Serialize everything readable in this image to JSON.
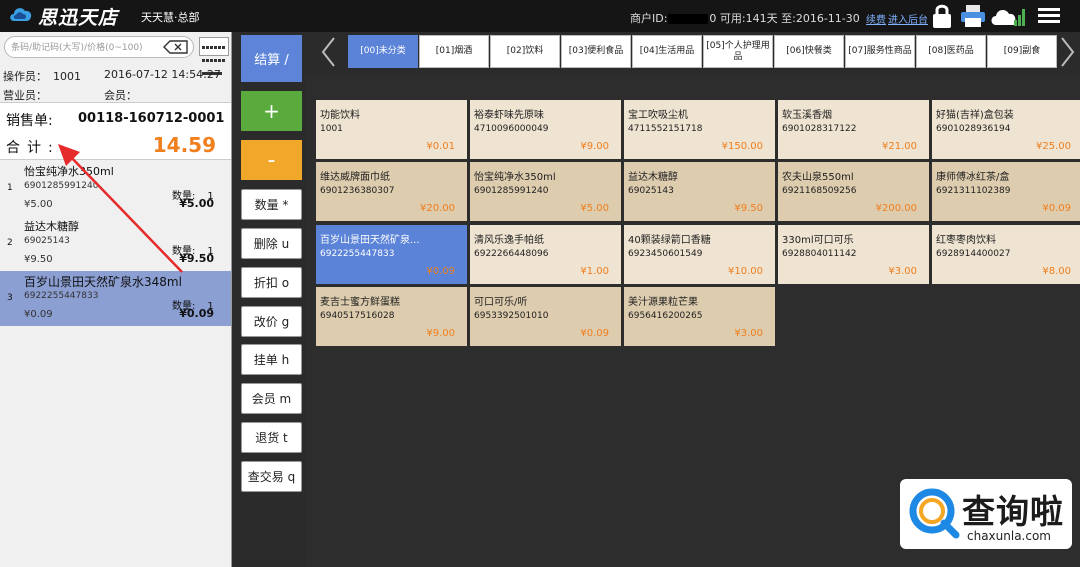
{
  "topbar": {
    "brand": "思迅天店",
    "brand_sub": "天天慧·总部",
    "merchant_prefix": "商户ID:",
    "merchant_suffix": "0 可用:141天 至:2016-11-30",
    "renew_link": "续费",
    "backend_link": "进入后台"
  },
  "search": {
    "placeholder": "条码/助记码(大写)/价格(0~100)"
  },
  "session": {
    "operator_label": "操作员：",
    "operator_value": "1001",
    "datetime": "2016-07-12 14:54:27",
    "clerk_label": "营业员：",
    "member_label": "会员："
  },
  "order": {
    "label": "销售单:",
    "number": "00118-160712-0001",
    "total_label": "合计:",
    "total_value": "14.59"
  },
  "cart": [
    {
      "index": "1",
      "name": "怡宝纯净水350ml",
      "code": "6901285991240",
      "qty_label": "数量:",
      "qty": "1",
      "price": "¥5.00",
      "subtotal": "¥5.00"
    },
    {
      "index": "2",
      "name": "益达木糖醇",
      "code": "69025143",
      "qty_label": "数量:",
      "qty": "1",
      "price": "¥9.50",
      "subtotal": "¥9.50"
    },
    {
      "index": "3",
      "name": "百岁山景田天然矿泉水348ml",
      "code": "6922255447833",
      "qty_label": "数量:",
      "qty": "1",
      "price": "¥0.09",
      "subtotal": "¥0.09"
    }
  ],
  "actions": {
    "checkout": "结算 /",
    "plus": "+",
    "minus": "-",
    "buttons": [
      "数量 *",
      "删除 u",
      "折扣 o",
      "改价 g",
      "挂单 h",
      "会员 m",
      "退货 t",
      "查交易 q"
    ]
  },
  "tabs": [
    "[00]未分类",
    "[01]烟酒",
    "[02]饮料",
    "[03]便利食品",
    "[04]生活用品",
    "[05]个人护理用品",
    "[06]快餐类",
    "[07]服务性商品",
    "[08]医药品",
    "[09]副食"
  ],
  "products": [
    {
      "name": "功能饮料",
      "code": "1001",
      "price": "¥0.01"
    },
    {
      "name": "裕泰虾味先原味",
      "code": "4710096000049",
      "price": "¥9.00"
    },
    {
      "name": "宝工吹吸尘机",
      "code": "4711552151718",
      "price": "¥150.00"
    },
    {
      "name": "软玉溪香烟",
      "code": "6901028317122",
      "price": "¥21.00"
    },
    {
      "name": "好猫(吉祥)盒包装",
      "code": "6901028936194",
      "price": "¥25.00"
    },
    {
      "name": "维达威牌面巾纸",
      "code": "6901236380307",
      "price": "¥20.00"
    },
    {
      "name": "怡宝纯净水350ml",
      "code": "6901285991240",
      "price": "¥5.00"
    },
    {
      "name": "益达木糖醇",
      "code": "69025143",
      "price": "¥9.50"
    },
    {
      "name": "农夫山泉550ml",
      "code": "6921168509256",
      "price": "¥200.00"
    },
    {
      "name": "康师傅冰红茶/盒",
      "code": "6921311102389",
      "price": "¥0.09"
    },
    {
      "name": "百岁山景田天然矿泉...",
      "code": "6922255447833",
      "price": "¥0.09"
    },
    {
      "name": "清风乐逸手帕纸",
      "code": "6922266448096",
      "price": "¥1.00"
    },
    {
      "name": "40颗装绿箭口香糖",
      "code": "6923450601549",
      "price": "¥10.00"
    },
    {
      "name": "330ml可口可乐",
      "code": "6928804011142",
      "price": "¥3.00"
    },
    {
      "name": "红枣枣肉饮料",
      "code": "6928914400027",
      "price": "¥8.00"
    },
    {
      "name": "麦吉士蜜方鲜蛋糕",
      "code": "6940517516028",
      "price": "¥9.00"
    },
    {
      "name": "可口可乐/听",
      "code": "6953392501010",
      "price": "¥0.09"
    },
    {
      "name": "美汁源果粒芒果",
      "code": "6956416200265",
      "price": "¥3.00"
    }
  ],
  "watermark": {
    "title": "查询啦",
    "url": "chaxunla.com"
  },
  "colors": {
    "topbar": "#151515",
    "accent_blue": "#5b83d8",
    "plus_green": "#5aaa3e",
    "minus_orange": "#f1a82a",
    "price_orange": "#f07f1e",
    "tile_light": "#efe3d1",
    "tile_dark": "#ddccae",
    "cart_selected": "#8c9fd3"
  },
  "icons": [
    "cloud-logo-icon",
    "clear-icon",
    "keyboard-icon",
    "lock-icon",
    "printer-icon",
    "cloud-signal-icon",
    "menu-icon",
    "chevron-left-icon",
    "chevron-right-icon",
    "arrow-annotation"
  ]
}
